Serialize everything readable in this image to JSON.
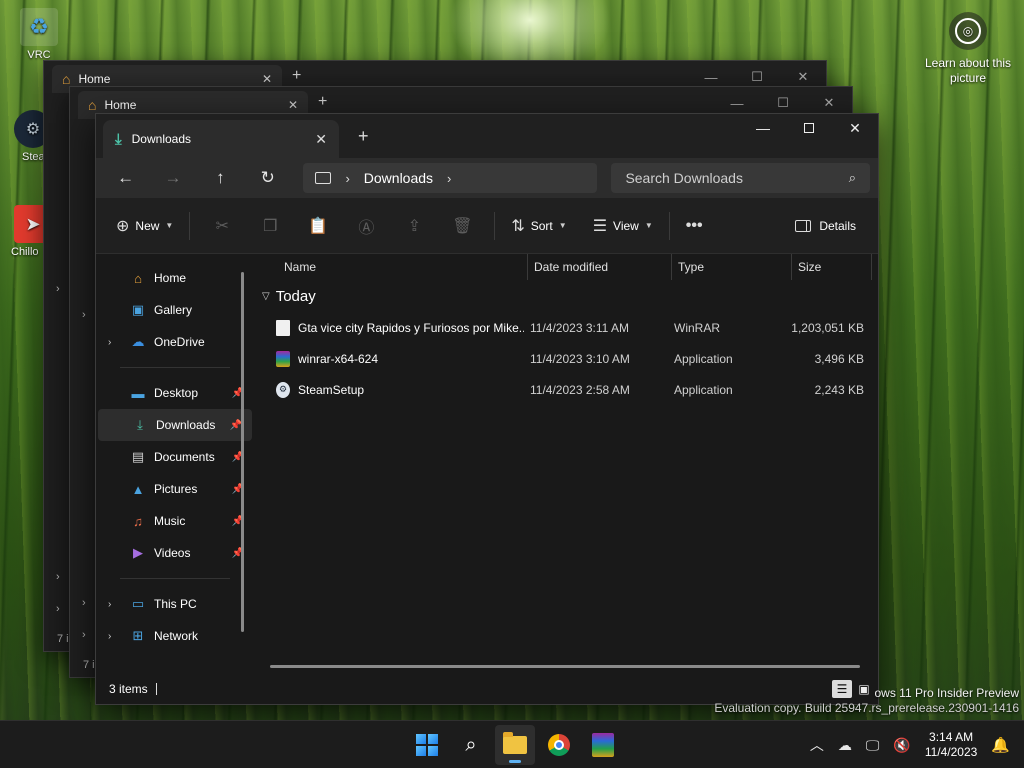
{
  "desktop": {
    "icons": [
      {
        "label": "VRC"
      },
      {
        "label": "Stea"
      },
      {
        "label": "Chillo"
      }
    ],
    "learn_about": "Learn about this picture",
    "watermark_line1": "ows 11 Pro Insider Preview",
    "watermark_line2": "Evaluation copy. Build 25947.rs_prerelease.230901-1416"
  },
  "background_windows": [
    {
      "tab_title": "Home",
      "status": "7 i"
    },
    {
      "tab_title": "Home",
      "status": "7 i"
    }
  ],
  "window": {
    "tab_title": "Downloads",
    "address": {
      "current": "Downloads"
    },
    "search_placeholder": "Search Downloads",
    "commands": {
      "new": "New",
      "sort": "Sort",
      "view": "View",
      "details": "Details"
    },
    "nav": {
      "home": "Home",
      "gallery": "Gallery",
      "onedrive": "OneDrive",
      "desktop": "Desktop",
      "downloads": "Downloads",
      "documents": "Documents",
      "pictures": "Pictures",
      "music": "Music",
      "videos": "Videos",
      "this_pc": "This PC",
      "network": "Network"
    },
    "columns": {
      "name": "Name",
      "date": "Date modified",
      "type": "Type",
      "size": "Size"
    },
    "group": "Today",
    "files": [
      {
        "name": "Gta vice city Rapidos y Furiosos por Mike...",
        "date": "11/4/2023 3:11 AM",
        "type": "WinRAR",
        "size": "1,203,051 KB",
        "icon": "document-icon"
      },
      {
        "name": "winrar-x64-624",
        "date": "11/4/2023 3:10 AM",
        "type": "Application",
        "size": "3,496 KB",
        "icon": "winrar-icon"
      },
      {
        "name": "SteamSetup",
        "date": "11/4/2023 2:58 AM",
        "type": "Application",
        "size": "2,243 KB",
        "icon": "steam-icon"
      }
    ],
    "status": "3 items"
  },
  "taskbar": {
    "time": "3:14 AM",
    "date": "11/4/2023"
  },
  "colors": {
    "accent": "#5fb2f2",
    "downloads_icon": "#4cc2a8",
    "window_bg": "#191919"
  }
}
